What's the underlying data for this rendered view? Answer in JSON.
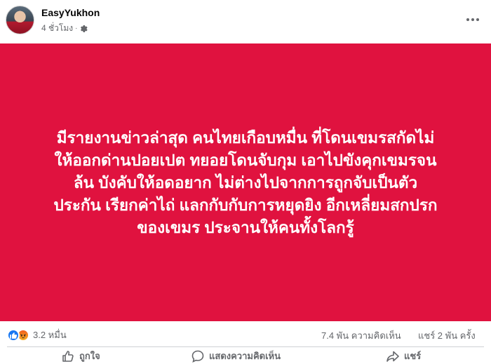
{
  "post": {
    "author": "EasyYukhon",
    "time": "4 ชั่วโมง",
    "audience_icon": "gear-icon",
    "background_color": "#e0123f",
    "text_lines": [
      "มีรายงานข่าวล่าสุด คนไทยเกือบหมื่น ที่โดนเขมรสกัดไม่",
      "ให้ออกด่านปอยเปต ทยอยโดนจับกุม เอาไปขังคุกเขมรจน",
      "ล้น บังคับให้อดอยาก ไม่ต่างไปจากการถูกจับเป็นตัว",
      "ประกัน เรียกค่าไถ่ แลกกับกับการหยุดยิง อีกเหลี่ยมสกปรก",
      "ของเขมร ประจานให้คนทั้งโลกรู้"
    ]
  },
  "stats": {
    "reactions_count": "3.2 หมื่น",
    "comments": "7.4 พัน ความคิดเห็น",
    "shares": "แชร์ 2 พัน ครั้ง",
    "reaction_icons": [
      "like-icon",
      "angry-icon"
    ]
  },
  "actions": {
    "like_label": "ถูกใจ",
    "comment_label": "แสดงความคิดเห็น",
    "share_label": "แชร์"
  }
}
